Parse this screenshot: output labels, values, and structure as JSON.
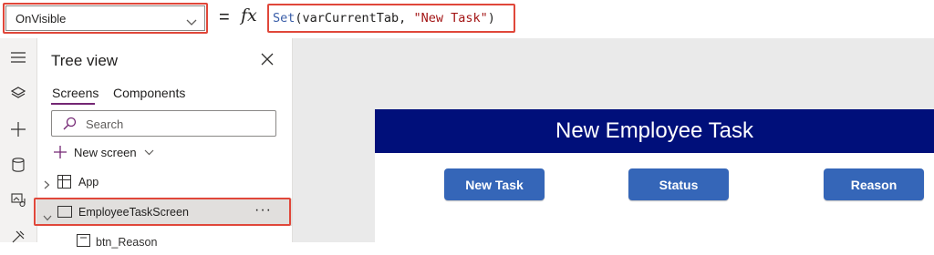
{
  "formula_bar": {
    "property": "OnVisible",
    "equals": "=",
    "fx": "fx",
    "formula_fn": "Set",
    "formula_open": "(varCurrentTab, ",
    "formula_string": "\"New Task\"",
    "formula_close": ")"
  },
  "left_rail": {
    "icons": [
      "hamburger-menu-icon",
      "layers-icon",
      "plus-icon",
      "database-icon",
      "media-icon",
      "advanced-tools-icon"
    ]
  },
  "tree_view": {
    "title": "Tree view",
    "tabs": [
      {
        "label": "Screens",
        "active": true
      },
      {
        "label": "Components",
        "active": false
      }
    ],
    "search_placeholder": "Search",
    "new_screen_label": "New screen",
    "items": [
      {
        "label": "App",
        "icon": "app-icon",
        "expanded": false,
        "selected": false
      },
      {
        "label": "EmployeeTaskScreen",
        "icon": "screen-icon",
        "expanded": true,
        "selected": true,
        "more": "···"
      },
      {
        "label": "btn_Reason",
        "icon": "button-control-icon",
        "expanded": false,
        "selected": false
      }
    ]
  },
  "canvas": {
    "header_title": "New Employee Task",
    "buttons": [
      "New Task",
      "Status",
      "Reason"
    ],
    "colors": {
      "header": "#000f7a",
      "button": "#3566b8",
      "highlight": "#e0473a",
      "tab_accent": "#742774"
    }
  }
}
